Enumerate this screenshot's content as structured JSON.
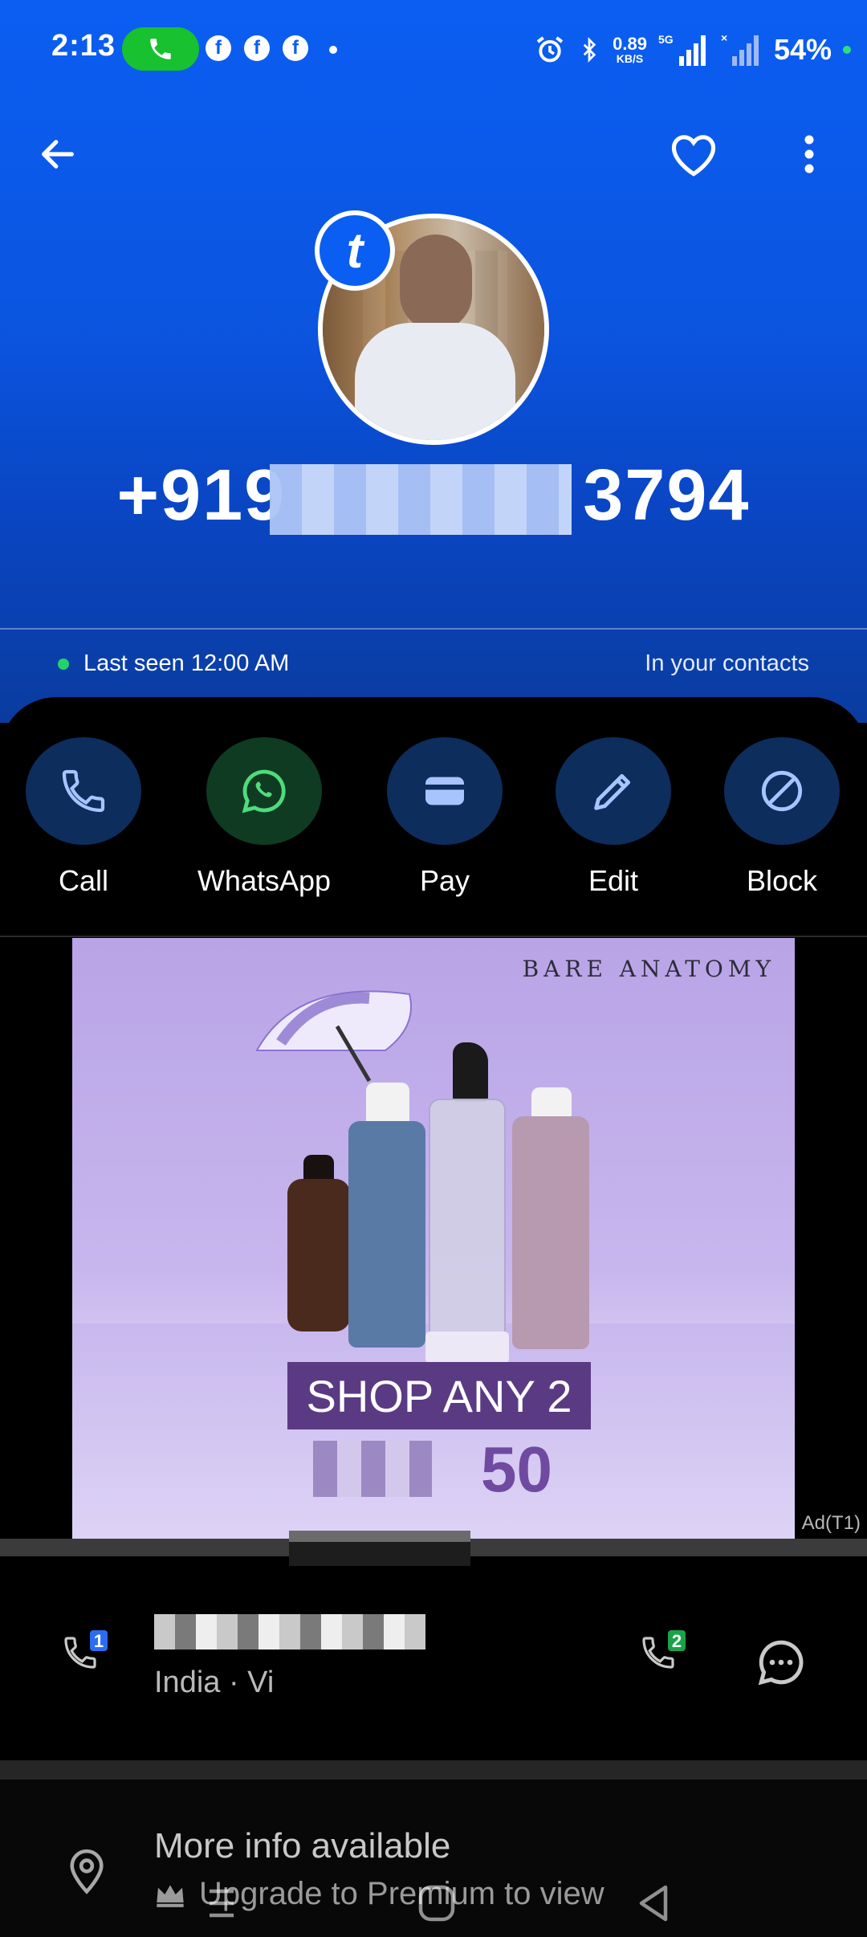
{
  "status_bar": {
    "time": "2:13",
    "net_speed_value": "0.89",
    "net_speed_unit": "KB/S",
    "network": "5G",
    "battery": "54%"
  },
  "contact": {
    "badge_letter": "t",
    "phone_number_prefix": "+919",
    "phone_number_suffix": "3794",
    "last_seen": "Last seen 12:00 AM",
    "contact_status": "In your contacts"
  },
  "actions": [
    {
      "label": "Call",
      "icon": "phone-icon"
    },
    {
      "label": "WhatsApp",
      "icon": "whatsapp-icon"
    },
    {
      "label": "Pay",
      "icon": "wallet-icon"
    },
    {
      "label": "Edit",
      "icon": "pencil-icon"
    },
    {
      "label": "Block",
      "icon": "block-icon"
    }
  ],
  "ad": {
    "brand": "BARE ANATOMY",
    "headline": "SHOP ANY 2",
    "price_visible": "50",
    "tag": "Ad(T1)"
  },
  "number_row": {
    "sim1_badge": "1",
    "sim2_badge": "2",
    "location": "India · Vi"
  },
  "more_info": {
    "title": "More info available",
    "upgrade_text": "Upgrade to Premium to view"
  },
  "colors": {
    "brand_blue": "#0b5ef2",
    "action_circle": "#0d2d5c",
    "whatsapp_circle": "#0f3b23",
    "online_green": "#24d26a"
  }
}
